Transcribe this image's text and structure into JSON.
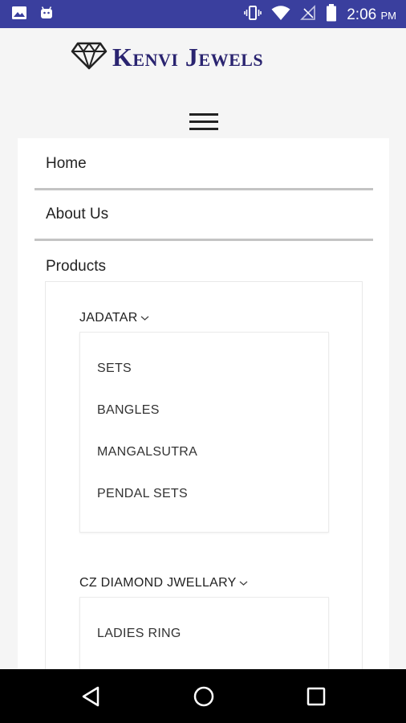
{
  "status_bar": {
    "time": "2:06",
    "ampm": "PM",
    "icons": [
      "image-icon",
      "android-icon",
      "vibrate-icon",
      "wifi-icon",
      "no-signal-icon",
      "battery-icon"
    ]
  },
  "brand": {
    "name": "Kenvi Jewels",
    "color": "#2a2470"
  },
  "nav": {
    "items": [
      {
        "label": "Home"
      },
      {
        "label": "About Us"
      },
      {
        "label": "Products"
      }
    ]
  },
  "products": {
    "categories": [
      {
        "heading": "JADATAR",
        "links": [
          "SETS",
          "BANGLES",
          "MANGALSUTRA",
          "PENDAL SETS"
        ]
      },
      {
        "heading": "CZ DIAMOND JWELLARY",
        "links": [
          "LADIES RING"
        ]
      }
    ]
  },
  "system_nav": {
    "buttons": [
      "back-icon",
      "home-icon",
      "recents-icon"
    ]
  },
  "colors": {
    "status_bar": "#3a3f9e",
    "divider": "#c4c4c4",
    "background": "#f5f5f5"
  }
}
